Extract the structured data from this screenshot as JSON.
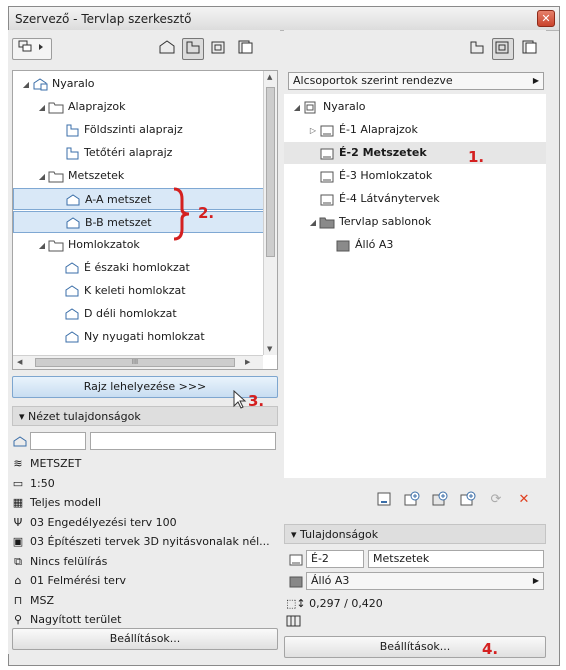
{
  "window": {
    "title": "Szervező - Tervlap szerkesztő",
    "close": "✕"
  },
  "left": {
    "tree": [
      {
        "label": "Nyaralo",
        "level": 0,
        "tri": "◢",
        "icon": "project-icon"
      },
      {
        "label": "Alaprajzok",
        "level": 1,
        "tri": "◢",
        "icon": "folder-icon"
      },
      {
        "label": "Földszinti alaprajz",
        "level": 2,
        "tri": "",
        "icon": "floorplan-icon"
      },
      {
        "label": "Tetőtéri alaprajz",
        "level": 2,
        "tri": "",
        "icon": "floorplan-icon"
      },
      {
        "label": "Metszetek",
        "level": 1,
        "tri": "◢",
        "icon": "folder-icon"
      },
      {
        "label": "A-A metszet",
        "level": 2,
        "tri": "",
        "icon": "section-icon",
        "selected": true
      },
      {
        "label": "B-B metszet",
        "level": 2,
        "tri": "",
        "icon": "section-icon",
        "selected": true
      },
      {
        "label": "Homlokzatok",
        "level": 1,
        "tri": "◢",
        "icon": "folder-icon"
      },
      {
        "label": "É északi homlokzat",
        "level": 2,
        "tri": "",
        "icon": "elevation-icon"
      },
      {
        "label": "K keleti homlokzat",
        "level": 2,
        "tri": "",
        "icon": "elevation-icon"
      },
      {
        "label": "D déli homlokzat",
        "level": 2,
        "tri": "",
        "icon": "elevation-icon"
      },
      {
        "label": "Ny nyugati homlokzat",
        "level": 2,
        "tri": "",
        "icon": "elevation-icon"
      }
    ],
    "place_button": "Rajz lehelyezése >>>",
    "view_props_title": "Nézet tulajdonságok",
    "view_props": [
      {
        "icon": "layer-icon",
        "text": "METSZET"
      },
      {
        "icon": "scale-icon",
        "text": "1:50"
      },
      {
        "icon": "model-icon",
        "text": "Teljes modell"
      },
      {
        "icon": "pen-icon",
        "text": "03 Engedélyezési terv 100"
      },
      {
        "icon": "display-icon",
        "text": "03 Építészeti tervek 3D nyitásvonalak nél..."
      },
      {
        "icon": "override-icon",
        "text": "Nincs felülírás"
      },
      {
        "icon": "renovation-icon",
        "text": "01 Felmérési terv"
      },
      {
        "icon": "dimension-icon",
        "text": "MSZ"
      },
      {
        "icon": "zoom-icon",
        "text": "Nagyított terület"
      }
    ],
    "settings_button": "Beállítások..."
  },
  "right": {
    "sort_label": "Alcsoportok szerint rendezve",
    "tree": [
      {
        "label": "Nyaralo",
        "level": 0,
        "tri": "◢",
        "icon": "layoutbook-icon",
        "bold": false
      },
      {
        "label": "É-1 Alaprajzok",
        "level": 1,
        "tri": "▷",
        "icon": "layout-icon",
        "bold": false
      },
      {
        "label": "É-2 Metszetek",
        "level": 1,
        "tri": "",
        "icon": "layout-icon",
        "bold": true,
        "highlight": true
      },
      {
        "label": "É-3 Homlokzatok",
        "level": 1,
        "tri": "",
        "icon": "layout-icon",
        "bold": false
      },
      {
        "label": "É-4 Látványtervek",
        "level": 1,
        "tri": "",
        "icon": "layout-icon",
        "bold": false
      },
      {
        "label": "Tervlap sablonok",
        "level": 1,
        "tri": "◢",
        "icon": "folder-dark-icon",
        "bold": false
      },
      {
        "label": "Álló A3",
        "level": 2,
        "tri": "",
        "icon": "master-icon",
        "bold": false
      }
    ],
    "props_title": "Tulajdonságok",
    "id_value": "É-2",
    "name_value": "Metszetek",
    "master_value": "Álló A3",
    "size_value": "0,297 / 0,420",
    "settings_button": "Beállítások..."
  },
  "annotations": {
    "a1": "1.",
    "a2": "2.",
    "a3": "3.",
    "a4": "4."
  },
  "scroll_grip": "III",
  "colors": {
    "annotation": "#d42020",
    "selection": "#d9e8f7",
    "accent": "#3a6ea8"
  }
}
